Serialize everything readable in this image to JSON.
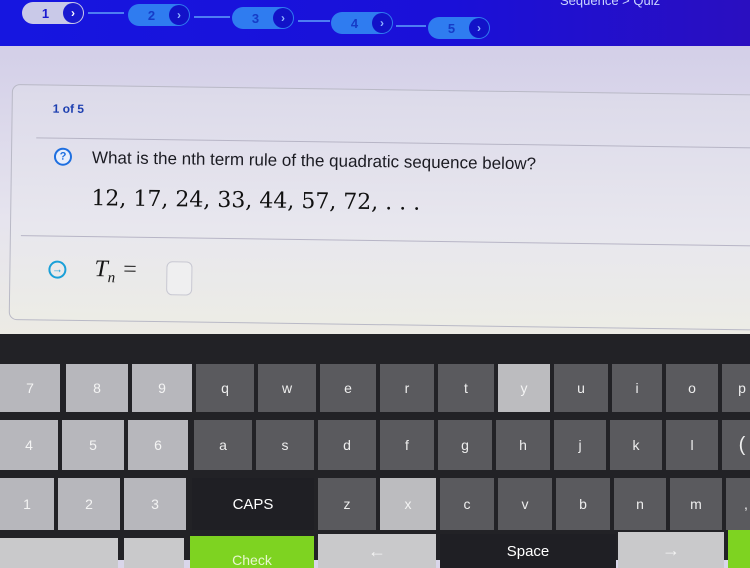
{
  "header": {
    "breadcrumb": "Sequence > Quiz",
    "steps": [
      {
        "label": "1",
        "state": "active"
      },
      {
        "label": "2",
        "state": "pending"
      },
      {
        "label": "3",
        "state": "pending"
      },
      {
        "label": "4",
        "state": "pending"
      },
      {
        "label": "5",
        "state": "pending"
      }
    ],
    "step_chevron": "›"
  },
  "question": {
    "counter": "1 of 5",
    "icon": "question-circle-icon",
    "icon_glyph": "?",
    "prompt": "What is the nth term rule of the quadratic sequence below?",
    "sequence": "12, 17, 24, 33, 44, 57, 72, . . .",
    "sequence_values": [
      12,
      17,
      24,
      33,
      44,
      57,
      72
    ]
  },
  "answer": {
    "icon": "arrow-right-circle-icon",
    "icon_glyph": "→",
    "label_main": "T",
    "label_sub": "n",
    "equals": "=",
    "value": ""
  },
  "keyboard": {
    "row1": [
      "7",
      "8",
      "9",
      "q",
      "w",
      "e",
      "r",
      "t",
      "y",
      "u",
      "i",
      "o",
      "p"
    ],
    "row2": [
      "4",
      "5",
      "6",
      "a",
      "s",
      "d",
      "f",
      "g",
      "h",
      "j",
      "k",
      "l",
      "("
    ],
    "row3": [
      "1",
      "2",
      "3",
      "CAPS",
      "z",
      "x",
      "c",
      "v",
      "b",
      "n",
      "m",
      ","
    ],
    "row4": {
      "check": "Check",
      "left": "←",
      "space": "Space",
      "right": "→"
    },
    "highlighted": [
      "y",
      "x"
    ],
    "colors": {
      "number_key": "#b7b7bc",
      "letter_key": "#5a5a5e",
      "dark_key": "#1f1f24",
      "green_key": "#7ed321"
    }
  }
}
